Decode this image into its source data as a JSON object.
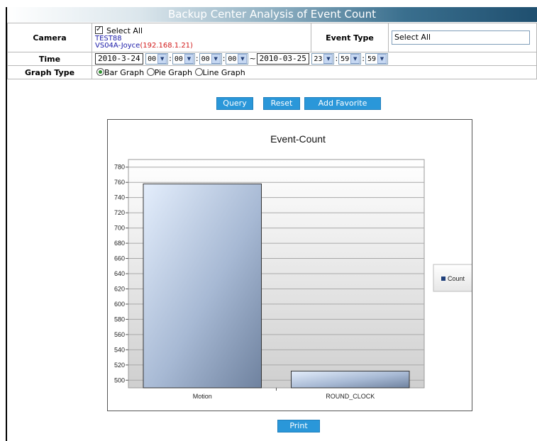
{
  "header": {
    "title": "Backup Center Analysis of Event Count"
  },
  "form": {
    "camera_label": "Camera",
    "select_all_label": "Select All",
    "cameras": [
      {
        "name": "TEST88",
        "ip": ""
      },
      {
        "name": "VS04A-Joyce",
        "ip": "(192.168.1.21)"
      }
    ],
    "event_type_label": "Event Type",
    "event_type_value": "Select All",
    "time_label": "Time",
    "start_date": "2010-3-24",
    "start_hour": "00",
    "start_min": "00",
    "start_sec": "00",
    "start_ms": "00",
    "tilde": "~",
    "end_date": "2010-03-25",
    "end_hour": "23",
    "end_min": "59",
    "end_sec": "59",
    "graph_type_label": "Graph Type",
    "graph_options": [
      "Bar Graph",
      "Pie Graph",
      "Line Graph"
    ],
    "graph_selected": "Bar Graph"
  },
  "buttons": {
    "query": "Query",
    "reset": "Reset",
    "favorite": "Add Favorite",
    "print": "Print"
  },
  "colors": {
    "button": "#2a97d9",
    "header_dark": "#1f4f6f",
    "ip": "#d21a1a",
    "camera": "#1a1aa8"
  },
  "chart_data": {
    "type": "bar",
    "title": "Event-Count",
    "categories": [
      "Motion",
      "ROUND_CLOCK"
    ],
    "series": [
      {
        "name": "Count",
        "values": [
          758,
          512
        ]
      }
    ],
    "ylim": [
      490,
      790
    ],
    "yticks": [
      500,
      520,
      540,
      560,
      580,
      600,
      620,
      640,
      660,
      680,
      700,
      720,
      740,
      760,
      780
    ],
    "grid": true,
    "legend": "right"
  }
}
